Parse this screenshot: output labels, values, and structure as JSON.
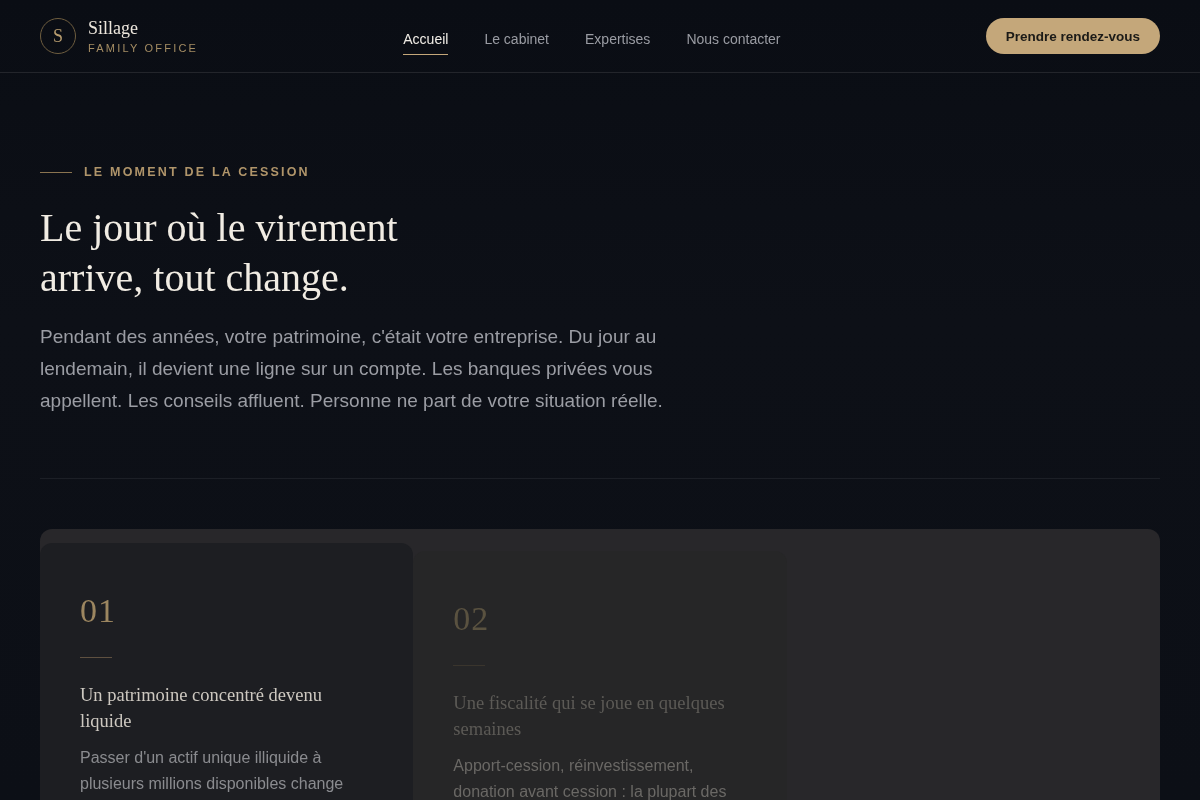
{
  "header": {
    "logo": {
      "initial": "S",
      "name": "Sillage",
      "tagline": "FAMILY OFFICE"
    },
    "nav": [
      {
        "label": "Accueil",
        "selected": true
      },
      {
        "label": "Le cabinet",
        "selected": false
      },
      {
        "label": "Expertises",
        "selected": false
      },
      {
        "label": "Nous contacter",
        "selected": false
      }
    ],
    "cta": "Prendre rendez-vous"
  },
  "hero": {
    "eyebrow": "LE MOMENT DE LA CESSION",
    "title": "Le jour où le virement arrive, tout change.",
    "body": "Pendant des années, votre patrimoine, c'était votre entreprise. Du jour au lendemain, il devient une ligne sur un compte. Les banques privées vous appellent. Les conseils affluent. Personne ne part de votre situation réelle."
  },
  "cards": [
    {
      "number": "01",
      "title": "Un patrimoine concentré devenu liquide",
      "description": "Passer d'un actif unique illiquide à plusieurs millions disponibles change",
      "selected": true
    },
    {
      "number": "02",
      "title": "Une fiscalité qui se joue en quelques semaines",
      "description": "Apport-cession, réinvestissement, donation avant cession : la plupart des",
      "selected": false
    }
  ]
}
